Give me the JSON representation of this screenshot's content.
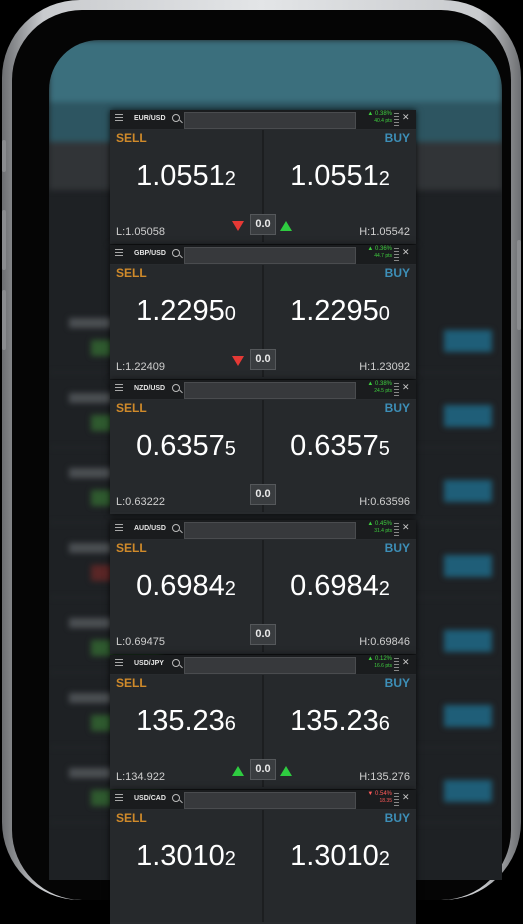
{
  "widgets": [
    {
      "symbol": "EUR/USD",
      "change_pct": "▲ 0.38%",
      "change_pts": "40.4 pts",
      "direction": "up",
      "sell_label": "SELL",
      "buy_label": "BUY",
      "sell_main": "1.0551",
      "sell_small": "2",
      "buy_main": "1.0551",
      "buy_small": "2",
      "low": "L:1.05058",
      "high": "H:1.05542",
      "spread": "0.0",
      "left_arrow": "down",
      "right_arrow": "up"
    },
    {
      "symbol": "GBP/USD",
      "change_pct": "▲ 0.36%",
      "change_pts": "44.7 pts",
      "direction": "up",
      "sell_label": "SELL",
      "buy_label": "BUY",
      "sell_main": "1.2295",
      "sell_small": "0",
      "buy_main": "1.2295",
      "buy_small": "0",
      "low": "L:1.22409",
      "high": "H:1.23092",
      "spread": "0.0",
      "left_arrow": "down",
      "right_arrow": ""
    },
    {
      "symbol": "NZD/USD",
      "change_pct": "▲ 0.38%",
      "change_pts": "24.5 pts",
      "direction": "up",
      "sell_label": "SELL",
      "buy_label": "BUY",
      "sell_main": "0.6357",
      "sell_small": "5",
      "buy_main": "0.6357",
      "buy_small": "5",
      "low": "L:0.63222",
      "high": "H:0.63596",
      "spread": "0.0",
      "left_arrow": "",
      "right_arrow": ""
    },
    {
      "symbol": "AUD/USD",
      "change_pct": "▲ 0.45%",
      "change_pts": "31.4 pts",
      "direction": "up",
      "sell_label": "SELL",
      "buy_label": "BUY",
      "sell_main": "0.6984",
      "sell_small": "2",
      "buy_main": "0.6984",
      "buy_small": "2",
      "low": "L:0.69475",
      "high": "H:0.69846",
      "spread": "0.0",
      "left_arrow": "",
      "right_arrow": ""
    },
    {
      "symbol": "USD/JPY",
      "change_pct": "▲ 0.12%",
      "change_pts": "16.6 pts",
      "direction": "up",
      "sell_label": "SELL",
      "buy_label": "BUY",
      "sell_main": "135.23",
      "sell_small": "6",
      "buy_main": "135.23",
      "buy_small": "6",
      "low": "L:134.922",
      "high": "H:135.276",
      "spread": "0.0",
      "left_arrow": "up",
      "right_arrow": "up"
    },
    {
      "symbol": "USD/CAD",
      "change_pct": "▼ 0.54%",
      "change_pts": "18.35",
      "direction": "down",
      "sell_label": "SELL",
      "buy_label": "BUY",
      "sell_main": "1.3010",
      "sell_small": "2",
      "buy_main": "1.3010",
      "buy_small": "2",
      "low": "",
      "high": "",
      "spread": "",
      "left_arrow": "",
      "right_arrow": ""
    }
  ]
}
